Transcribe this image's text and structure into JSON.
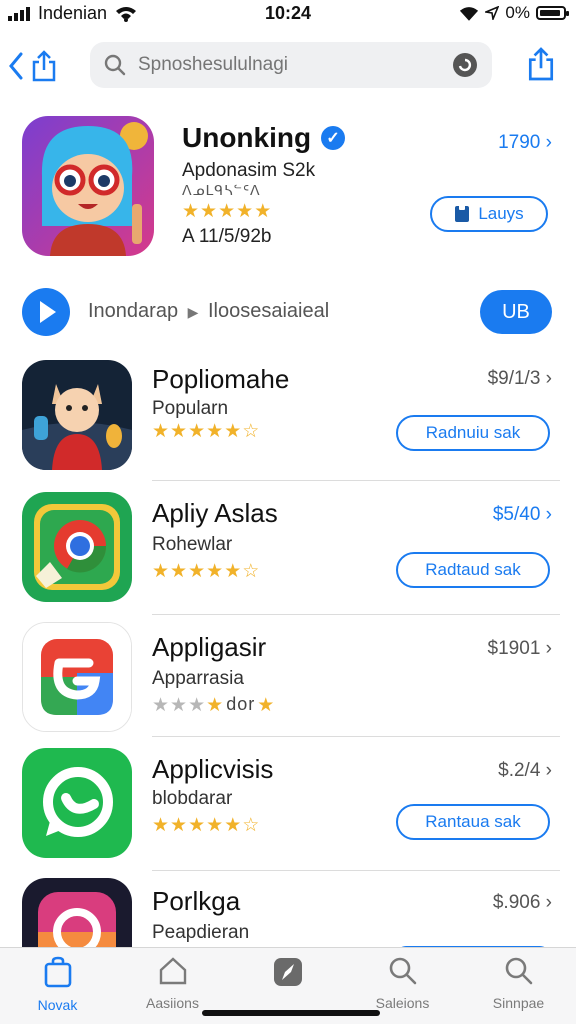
{
  "status": {
    "carrier": "Indenian",
    "time": "10:24",
    "battery": "0%"
  },
  "search": {
    "placeholder": "Spnoshesululnagi"
  },
  "featured": {
    "title": "Unonking",
    "subtitle": "Apdonasim  S2k",
    "subtitle2": "ᐱᓄᒪᑫᓴᓪᑦᐱ",
    "rating": 4.5,
    "meta": "A 11/5/92b",
    "price": "1790",
    "button": "Lauys"
  },
  "playrow": {
    "label": "Inondarap",
    "label2": "Iloosesaiaieal",
    "pill": "UB"
  },
  "apps": [
    {
      "name": "Popliomahe",
      "sub": "Popularn",
      "rating": 4.5,
      "price": "$9/1/3",
      "price_blue": false,
      "button": "Radnuiu sak"
    },
    {
      "name": "Apliy Aslas",
      "sub": "Rohewlar",
      "rating": 4.5,
      "price": "$5/40",
      "price_blue": true,
      "button": "Radtaud sak"
    },
    {
      "name": "Appligasir",
      "sub": "Apparrasia",
      "rating_text": "dor",
      "price": "$1901",
      "price_blue": false,
      "button": ""
    },
    {
      "name": "Applicvisis",
      "sub": "blobdarar",
      "rating": 4.5,
      "price": "$.2/4",
      "price_blue": false,
      "button": "Rantaua sak"
    },
    {
      "name": "Porlkga",
      "sub": "Peapdieran",
      "price": "$.906",
      "price_blue": false,
      "button": ""
    }
  ],
  "tabs": [
    {
      "label": "Novak",
      "icon": "store-bag-icon"
    },
    {
      "label": "Aasiions",
      "icon": "home-icon"
    },
    {
      "label": "",
      "icon": "compass-icon"
    },
    {
      "label": "Saleions",
      "icon": "search-icon"
    },
    {
      "label": "Sinnpae",
      "icon": "search-icon"
    }
  ],
  "colors": {
    "accent": "#1a7bf0",
    "star": "#f1b22a"
  }
}
